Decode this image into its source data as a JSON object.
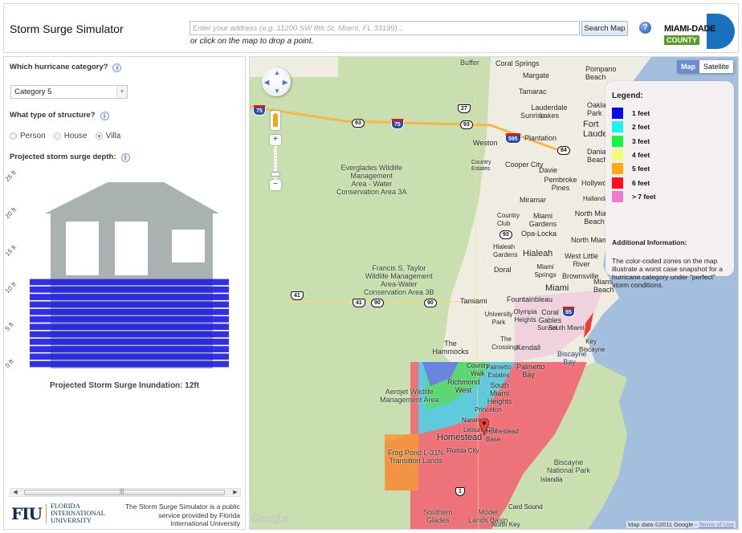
{
  "header": {
    "title": "Storm Surge Simulator",
    "address_placeholder": "Enter your address (e.g. 11200 SW 8th St, Miami, FL 33199)...",
    "address_value": "",
    "hint": "or click on the map to drop a point.",
    "search_button": "Search Map",
    "help_icon": "?",
    "logo": {
      "name": "MIAMI-DADE",
      "sub": "COUNTY",
      "blue": "#1a71bf",
      "green": "#5a9b2a"
    }
  },
  "left_panel": {
    "category_question": "Which hurricane category?",
    "category_selected": "Category 5",
    "structure_question": "What type of structure?",
    "structure_options": [
      {
        "label": "Person",
        "checked": false
      },
      {
        "label": "House",
        "checked": false
      },
      {
        "label": "Villa",
        "checked": true
      }
    ],
    "depth_question": "Projected storm surge depth:",
    "info_icon": "i",
    "chart": {
      "y_ticks": [
        "0 ft",
        "5 ft",
        "10 ft",
        "15 ft",
        "20 ft",
        "25 ft"
      ],
      "y_max_ft": 25,
      "surge_depth_ft": 12,
      "water_color": "#2020e0",
      "house_color": "#a9b1b1"
    },
    "inundation_label": "Projected Storm Surge Inundation: 12ft",
    "footer": {
      "fiu_mark": "FIU",
      "fiu_lines": [
        "FLORIDA",
        "INTERNATIONAL",
        "UNIVERSITY"
      ],
      "note": "The Storm Surge Simulator is a public service provided by Florida International University"
    }
  },
  "map": {
    "type_buttons": {
      "map": "Map",
      "satellite": "Satellite",
      "active": "Map"
    },
    "legend": {
      "title": "Legend:",
      "items": [
        {
          "label": "1 feet",
          "color": "#0a0ae6"
        },
        {
          "label": "2 feet",
          "color": "#18f5f0"
        },
        {
          "label": "3 feet",
          "color": "#18f540"
        },
        {
          "label": "4 feet",
          "color": "#f0ff78"
        },
        {
          "label": "5 feet",
          "color": "#ffaa10"
        },
        {
          "label": "6 feet",
          "color": "#ff1020"
        },
        {
          "label": "> 7 feet",
          "color": "#f07ad0"
        }
      ],
      "additional_title": "Additional Information:",
      "additional_text": "The color-coded zones on the map illustrate a worst case snapshot for a hurricane category under \"perfect\" storm conditions."
    },
    "places": {
      "everglades_3a": "Everglades Wildlife\nManagement\nArea - Water\nConservation Area 3A",
      "taylor_3b": "Francis S. Taylor\nWildlife Management\nArea-Water\nConservation Area 3B",
      "aerojet": "Aerojet Wildlife\nManagement Area",
      "frog_pond": "Frog Pond L-31N\nTransition Lands",
      "southern_glades": "Southern\nGlades",
      "model_lands": "Model\nLands Basin",
      "biscayne_np": "Biscayne\nNational Park",
      "buffer": "Buffer"
    },
    "cities": [
      "Coral Springs",
      "Margate",
      "Pompano Beach",
      "Tamarac",
      "Lauderdale Lakes",
      "Oakland Park",
      "Sunrise",
      "Fort Lauderdale",
      "Plantation",
      "Weston",
      "Dania Beach",
      "Country Estates",
      "Cooper City",
      "Davie",
      "Pembroke Pines",
      "Hollywood",
      "Hallandale",
      "Miramar",
      "Country Club",
      "Miami Gardens",
      "North Miami Beach",
      "Opa-Locka",
      "North Miami",
      "Hialeah Gardens",
      "Hialeah",
      "West Little River",
      "Doral",
      "Miami Springs",
      "Brownsville",
      "Miami",
      "Miami Beach",
      "Tamiami",
      "Fountainbleau",
      "University Park",
      "Olympia Heights",
      "Coral Gables",
      "The Hammocks",
      "Kendall",
      "The Crossings",
      "Sunset",
      "South Miami",
      "Key Biscayne",
      "Country Walk",
      "Palmetto Estates",
      "Palmetto Bay",
      "Richmond West",
      "South Miami Heights",
      "Princeton",
      "Naranja",
      "Leisure City",
      "Homestead",
      "Florida City",
      "Homestead Base",
      "Islandia",
      "Card Sound",
      "North Key"
    ],
    "water": [
      "Biscayne Bay"
    ],
    "roads": [
      "75",
      "27",
      "93",
      "595",
      "84",
      "41",
      "90",
      "95",
      "1"
    ],
    "attribution": "Map data ©2011 Google - ",
    "terms": "Terms of Use",
    "google": "Google"
  }
}
